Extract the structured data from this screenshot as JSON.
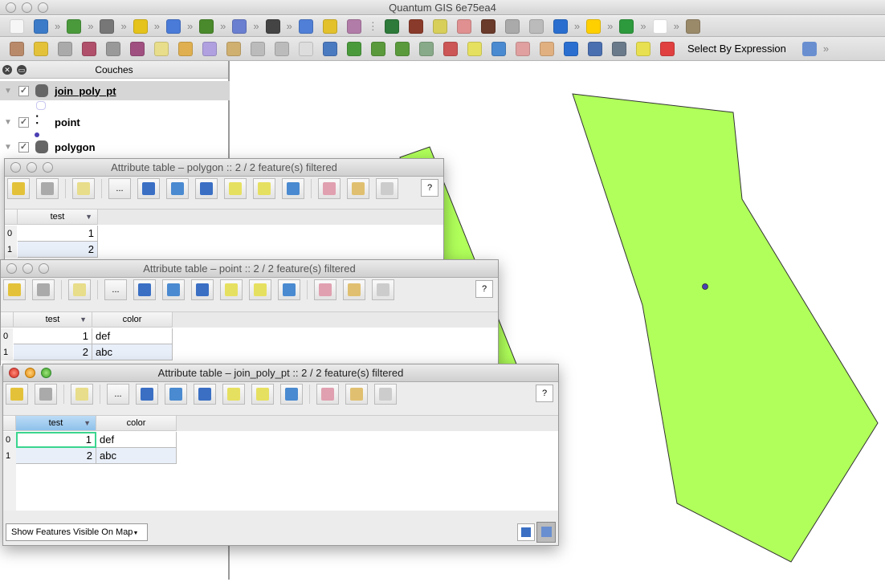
{
  "app": {
    "title": "Quantum GIS 6e75ea4"
  },
  "toolbar1": {
    "icons": [
      "new-project",
      "open-project",
      "chevron",
      "add-vector",
      "chevron",
      "undo",
      "chevron",
      "plugin-yellow",
      "chevron",
      "book",
      "chevron",
      "histogram",
      "chevron",
      "label",
      "chevron",
      "dark-circle",
      "chevron",
      "raster-blue",
      "raster-star",
      "raster-remove",
      "sep",
      "add-raster-green",
      "add-raster-red",
      "raster-yellow",
      "raster-pink",
      "raster-tools",
      "raster-frame",
      "raster-frame2",
      "water-drops",
      "chevron",
      "d2-yellow",
      "chevron",
      "green-plugin",
      "chevron",
      "csw",
      "chevron",
      "folder-gear"
    ]
  },
  "toolbar2": {
    "icons": [
      "digitize",
      "pencil",
      "save-edits",
      "add-polygon",
      "move",
      "node",
      "delete",
      "cut",
      "copy",
      "paste",
      "vertex-add",
      "vertex-edit",
      "xy",
      "pan",
      "pan-to-selection",
      "zoom-in",
      "zoom-out",
      "zoom-native",
      "zoom-full",
      "zoom-layer",
      "zoom-selection",
      "zoom-last",
      "zoom-next",
      "refresh",
      "identify",
      "action-gear",
      "select",
      "deselect"
    ],
    "select_by_expression": "Select By Expression"
  },
  "colors": {
    "polygon_fill": "#b0ff5a",
    "point": "#4b3fb3",
    "selected_cell": "#3ad58e",
    "header_selected": "#8ec1ea"
  },
  "layers": {
    "title": "Couches",
    "items": [
      {
        "name": "join_poly_pt",
        "checked": true
      },
      {
        "name": "point",
        "checked": true
      },
      {
        "name": "polygon",
        "checked": true
      }
    ]
  },
  "windows": {
    "polygon": {
      "title": "Attribute table – polygon :: 2 / 2 feature(s) filtered",
      "columns": [
        "test"
      ],
      "rows": [
        {
          "idx": "0",
          "test": "1"
        },
        {
          "idx": "1",
          "test": "2"
        }
      ],
      "help": "?"
    },
    "point": {
      "title": "Attribute table – point :: 2 / 2 feature(s) filtered",
      "columns": [
        "test",
        "color"
      ],
      "rows": [
        {
          "idx": "0",
          "test": "1",
          "color": "def"
        },
        {
          "idx": "1",
          "test": "2",
          "color": "abc"
        }
      ],
      "help": "?"
    },
    "join": {
      "title": "Attribute table – join_poly_pt :: 2 / 2 feature(s) filtered",
      "columns": [
        "test",
        "color"
      ],
      "rows": [
        {
          "idx": "0",
          "test": "1",
          "color": "def"
        },
        {
          "idx": "1",
          "test": "2",
          "color": "abc"
        }
      ],
      "help": "?",
      "filter_button": "Show Features Visible On Map"
    },
    "tool_dots": "..."
  }
}
